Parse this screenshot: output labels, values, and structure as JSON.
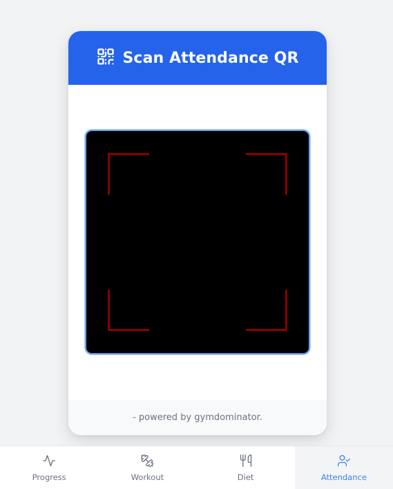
{
  "header": {
    "title": "Scan Attendance QR",
    "icon": "qr-code-icon"
  },
  "footer": {
    "text": "- powered by gymdominator."
  },
  "colors": {
    "header": "#2563eb",
    "active_tab": "#3b82f6",
    "scanner_corners": "#8b0000"
  },
  "nav": {
    "items": [
      {
        "label": "Progress",
        "icon": "activity-icon",
        "active": false
      },
      {
        "label": "Workout",
        "icon": "dumbbell-icon",
        "active": false
      },
      {
        "label": "Diet",
        "icon": "utensils-icon",
        "active": false
      },
      {
        "label": "Attendance",
        "icon": "user-check-icon",
        "active": true
      }
    ]
  }
}
